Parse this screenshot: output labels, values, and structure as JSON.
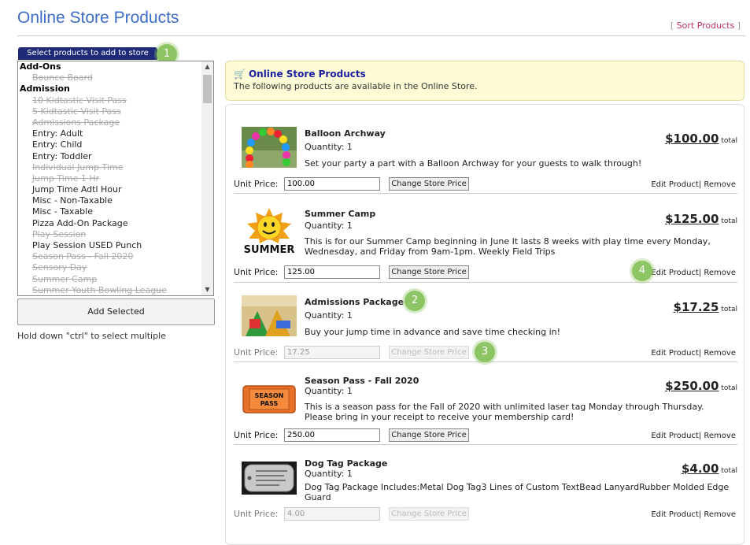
{
  "page": {
    "title": "Online Store Products",
    "sort_link": "Sort Products"
  },
  "selector": {
    "header": "Select products to add to store",
    "items": [
      {
        "label": "Add-Ons",
        "type": "group"
      },
      {
        "label": "Bounce Board",
        "type": "disabled"
      },
      {
        "label": "Admission",
        "type": "group"
      },
      {
        "label": "10 Kidtastic Visit Pass",
        "type": "disabled"
      },
      {
        "label": "5 Kidtastic Visit Pass",
        "type": "disabled"
      },
      {
        "label": "Admissions Package",
        "type": "disabled"
      },
      {
        "label": "Entry: Adult",
        "type": "item"
      },
      {
        "label": "Entry: Child",
        "type": "item"
      },
      {
        "label": "Entry: Toddler",
        "type": "item"
      },
      {
        "label": "Individual Jump Time",
        "type": "disabled"
      },
      {
        "label": "Jump Time 1 Hr",
        "type": "disabled"
      },
      {
        "label": "Jump Time Adtl Hour",
        "type": "item"
      },
      {
        "label": "Misc - Non-Taxable",
        "type": "item"
      },
      {
        "label": "Misc - Taxable",
        "type": "item"
      },
      {
        "label": "Pizza Add-On Package",
        "type": "item"
      },
      {
        "label": "Play Session",
        "type": "disabled"
      },
      {
        "label": "Play Session USED Punch",
        "type": "item"
      },
      {
        "label": "Season Pass - Fall 2020",
        "type": "disabled"
      },
      {
        "label": "Sensory Day",
        "type": "disabled"
      },
      {
        "label": "Summer Camp",
        "type": "disabled"
      },
      {
        "label": "Summer Youth Bowling League",
        "type": "disabled"
      }
    ],
    "add_button": "Add Selected",
    "hint": "Hold down \"ctrl\" to select multiple"
  },
  "info": {
    "title": "Online Store Products",
    "description": "The following products are available in the Online Store."
  },
  "callouts": [
    "1",
    "2",
    "3",
    "4"
  ],
  "products": [
    {
      "name": "Balloon Archway",
      "quantity": "Quantity: 1",
      "description": "Set your party a part with a Balloon Archway for your guests to walk through!",
      "price": "$100.00",
      "total": "total",
      "unit_label": "Unit Price:",
      "unit_price": "100.00",
      "change_label": "Change Store Price",
      "edit_label": "Edit Product",
      "remove_label": "Remove",
      "enabled": true
    },
    {
      "name": "Summer Camp",
      "quantity": "Quantity: 1",
      "description": "This is for our Summer Camp beginning in June It lasts 8 weeks with play time every Monday, Wednesday, and Friday from 9am-1pm. Weekly Field Trips",
      "price": "$125.00",
      "total": "total",
      "unit_label": "Unit Price:",
      "unit_price": "125.00",
      "change_label": "Change Store Price",
      "edit_label": "Edit Product",
      "remove_label": "Remove",
      "enabled": true
    },
    {
      "name": "Admissions Package",
      "quantity": "Quantity: 1",
      "description": "Buy your jump time in advance and save time checking in!",
      "price": "$17.25",
      "total": "total",
      "unit_label": "Unit Price:",
      "unit_price": "17.25",
      "change_label": "Change Store Price",
      "edit_label": "Edit Product",
      "remove_label": "Remove",
      "enabled": false
    },
    {
      "name": "Season Pass - Fall 2020",
      "quantity": "Quantity: 1",
      "description": "This is a season pass for the Fall of 2020 with unlimited laser tag Monday through Thursday. Please bring in your receipt to receive your membership card!",
      "price": "$250.00",
      "total": "total",
      "unit_label": "Unit Price:",
      "unit_price": "250.00",
      "change_label": "Change Store Price",
      "edit_label": "Edit Product",
      "remove_label": "Remove",
      "enabled": true
    },
    {
      "name": "Dog Tag Package",
      "quantity": "Quantity: 1",
      "description": "Dog Tag Package Includes:Metal Dog Tag3 Lines of Custom TextBead LanyardRubber Molded Edge Guard",
      "price": "$4.00",
      "total": "total",
      "unit_label": "Unit Price:",
      "unit_price": "4.00",
      "change_label": "Change Store Price",
      "edit_label": "Edit Product",
      "remove_label": "Remove",
      "enabled": false
    }
  ],
  "thumb_text": {
    "summer": "SUMMER",
    "season_pass": "SEASON PASS"
  }
}
